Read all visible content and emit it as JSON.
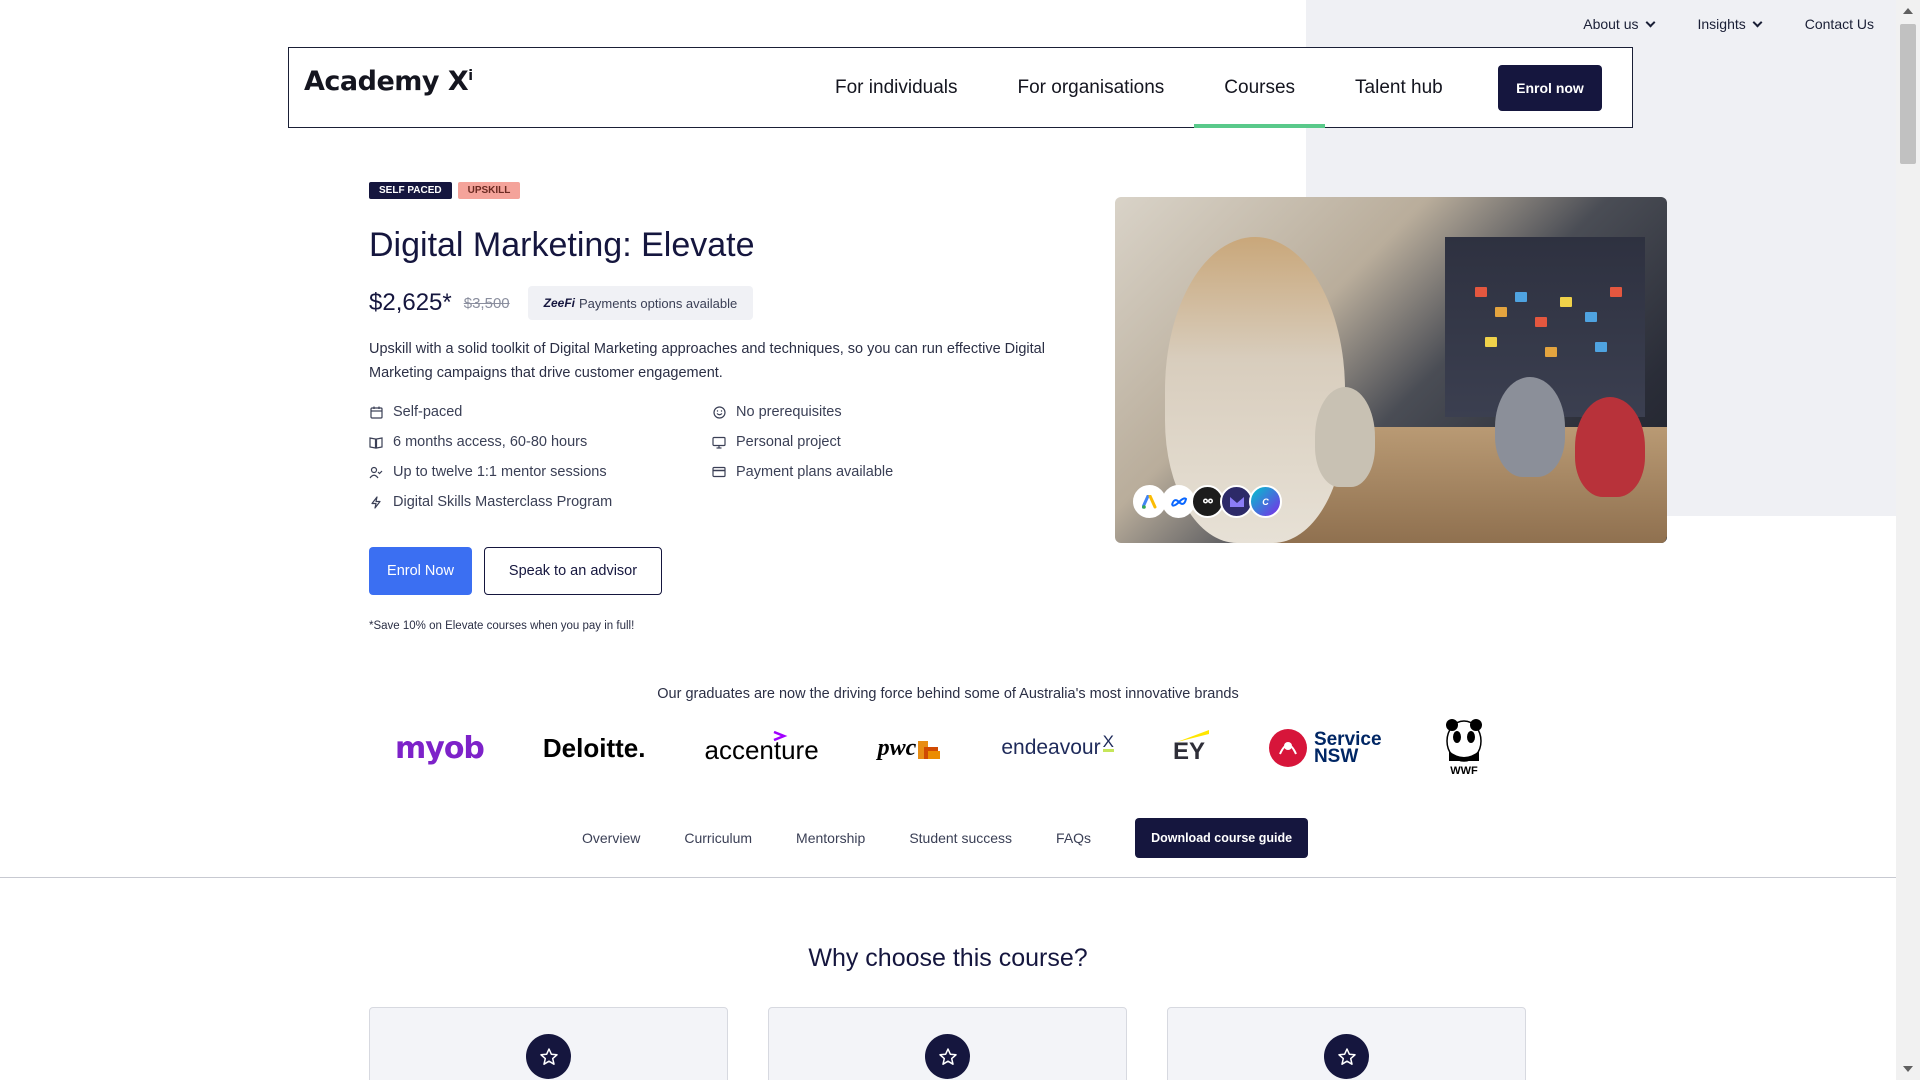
{
  "util_nav": {
    "about": "About us",
    "insights": "Insights",
    "contact": "Contact Us"
  },
  "header": {
    "logo_text": "Academy X",
    "logo_sup": "i",
    "links": [
      "For individuals",
      "For organisations",
      "Courses",
      "Talent hub"
    ],
    "active_link": "Courses",
    "enrol": "Enrol now"
  },
  "course": {
    "badges": [
      "SELF PACED",
      "UPSKILL"
    ],
    "title": "Digital Marketing: Elevate",
    "price": "$2,625*",
    "price_old": "$3,500",
    "zeefi_brand": "ZeeFi",
    "zeefi_text": "Payments options available",
    "description": "Upskill with a solid toolkit of Digital Marketing approaches and techniques, so you can run effective Digital Marketing campaigns that drive customer engagement.",
    "features": [
      {
        "text": "Self-paced",
        "icon": "calendar-icon"
      },
      {
        "text": "No prerequisites",
        "icon": "smile-icon"
      },
      {
        "text": "6 months access, 60-80 hours",
        "icon": "book-icon"
      },
      {
        "text": "Personal project",
        "icon": "monitor-icon"
      },
      {
        "text": "Up to twelve 1:1 mentor sessions",
        "icon": "user-check-icon"
      },
      {
        "text": "Payment plans available",
        "icon": "credit-card-icon"
      },
      {
        "text": "Digital Skills Masterclass Program",
        "icon": "lightning-icon"
      }
    ],
    "enrol_now": "Enrol Now",
    "speak_advisor": "Speak to an advisor",
    "save_note": "*Save 10% on Elevate courses when you pay in full!"
  },
  "tools": [
    "Google Ads",
    "Meta",
    "Hootsuite",
    "Mailchimp",
    "Canva"
  ],
  "graduates": {
    "text": "Our graduates are now the driving force behind some of Australia's most innovative brands",
    "brands": [
      "myob",
      "Deloitte.",
      "accenture",
      "pwc",
      "endeavour",
      "EY",
      "Service NSW",
      "WWF"
    ]
  },
  "tabs": {
    "items": [
      "Overview",
      "Curriculum",
      "Mentorship",
      "Student success",
      "FAQs"
    ],
    "download": "Download course guide"
  },
  "why": {
    "title": "Why choose this course?"
  },
  "colors": {
    "navy": "#15163e",
    "primary_blue": "#3b6ff2",
    "active_green": "#59c98a",
    "badge_salmon": "#f4a39a"
  }
}
